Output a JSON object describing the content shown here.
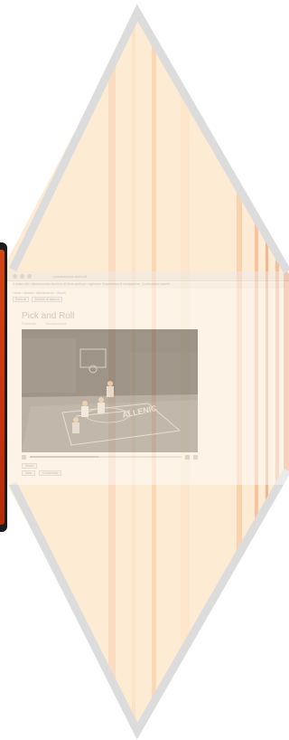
{
  "browser": {
    "url_text": "· · ·  practice/pick-and-roll"
  },
  "notice": {
    "text": "Il nostro sito utilizza cookie tecnici e di terze parti per migliorare l'esperienza di navigazione. Continuando accetti."
  },
  "breadcrumb": {
    "text": "Home › Basket › Allenamento › Giochi",
    "links": [
      "Esercizi",
      "Schemi di attacco"
    ]
  },
  "page": {
    "title": "Pick and Roll",
    "meta_left": "Pubblicato",
    "meta_right": "Visualizzazioni"
  },
  "video": {
    "court_text": "ALLENIC",
    "progress": 0.45
  },
  "actions": {
    "share_label": "Share",
    "rating_label": "Vota",
    "comment_label": "Commenta"
  },
  "colors": {
    "frame_accent": "#c8330c",
    "background_wash": "#fdebd3",
    "diamond_stroke": "#dcdcdc"
  }
}
